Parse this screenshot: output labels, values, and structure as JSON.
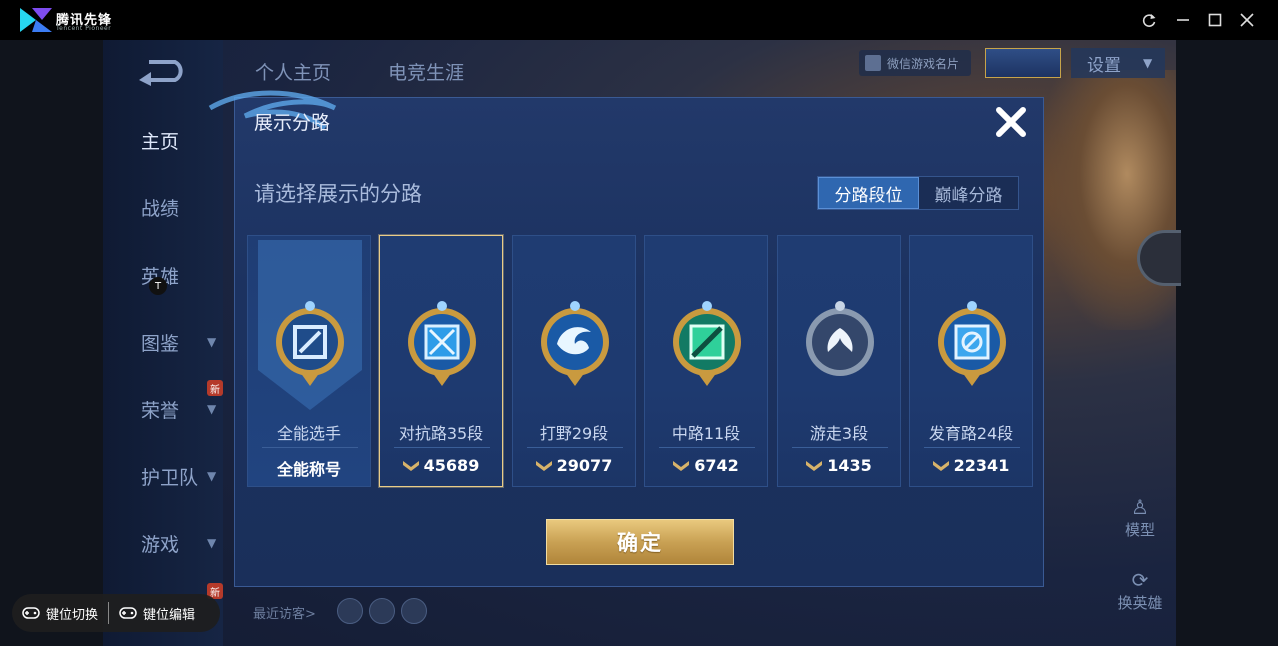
{
  "window": {
    "app_name": "腾讯先锋",
    "app_sub": "Tencent Pioneer",
    "controls": [
      "refresh-icon",
      "minimize-icon",
      "maximize-icon",
      "close-icon"
    ]
  },
  "game": {
    "top_tabs": [
      "个人主页",
      "电竞生涯"
    ],
    "wx_card": "微信游戏名片",
    "settings": "设置",
    "sidebar": {
      "items": [
        {
          "label": "主页",
          "active": true,
          "chevron": false,
          "badge": ""
        },
        {
          "label": "战绩",
          "active": false,
          "chevron": false,
          "badge": ""
        },
        {
          "label": "英雄",
          "active": false,
          "chevron": false,
          "badge": ""
        },
        {
          "label": "图鉴",
          "active": false,
          "chevron": true,
          "badge": ""
        },
        {
          "label": "荣誉",
          "active": false,
          "chevron": true,
          "badge": "新"
        },
        {
          "label": "护卫队",
          "active": false,
          "chevron": true,
          "badge": ""
        },
        {
          "label": "游戏",
          "active": false,
          "chevron": true,
          "badge": "新"
        }
      ]
    },
    "recent_visitors": "最近访客>",
    "right_actions": [
      "模型",
      "换英雄"
    ]
  },
  "modal": {
    "title": "展示分路",
    "subtitle": "请选择展示的分路",
    "segment": {
      "options": [
        "分路段位",
        "巅峰分路"
      ],
      "selected": 0
    },
    "cards": [
      {
        "name": "全能选手",
        "value": "全能称号",
        "type": "title",
        "emblem_color": "#7db3e8"
      },
      {
        "name": "对抗路35段",
        "value": "45689",
        "type": "score",
        "emblem_color": "#4fb4f0",
        "selected": true
      },
      {
        "name": "打野29段",
        "value": "29077",
        "type": "score",
        "emblem_color": "#4aa8e8"
      },
      {
        "name": "中路11段",
        "value": "6742",
        "type": "score",
        "emblem_color": "#2fd09a"
      },
      {
        "name": "游走3段",
        "value": "1435",
        "type": "score",
        "emblem_color": "#b9c8de"
      },
      {
        "name": "发育路24段",
        "value": "22341",
        "type": "score",
        "emblem_color": "#3ca6ee"
      }
    ],
    "confirm": "确定"
  },
  "keymap": {
    "switch": "键位切换",
    "edit": "键位编辑",
    "marker": "T"
  },
  "colors": {
    "gold": "#e9cc88",
    "accent_blue": "#2f67b0",
    "modal_bg": "#1c3260"
  }
}
